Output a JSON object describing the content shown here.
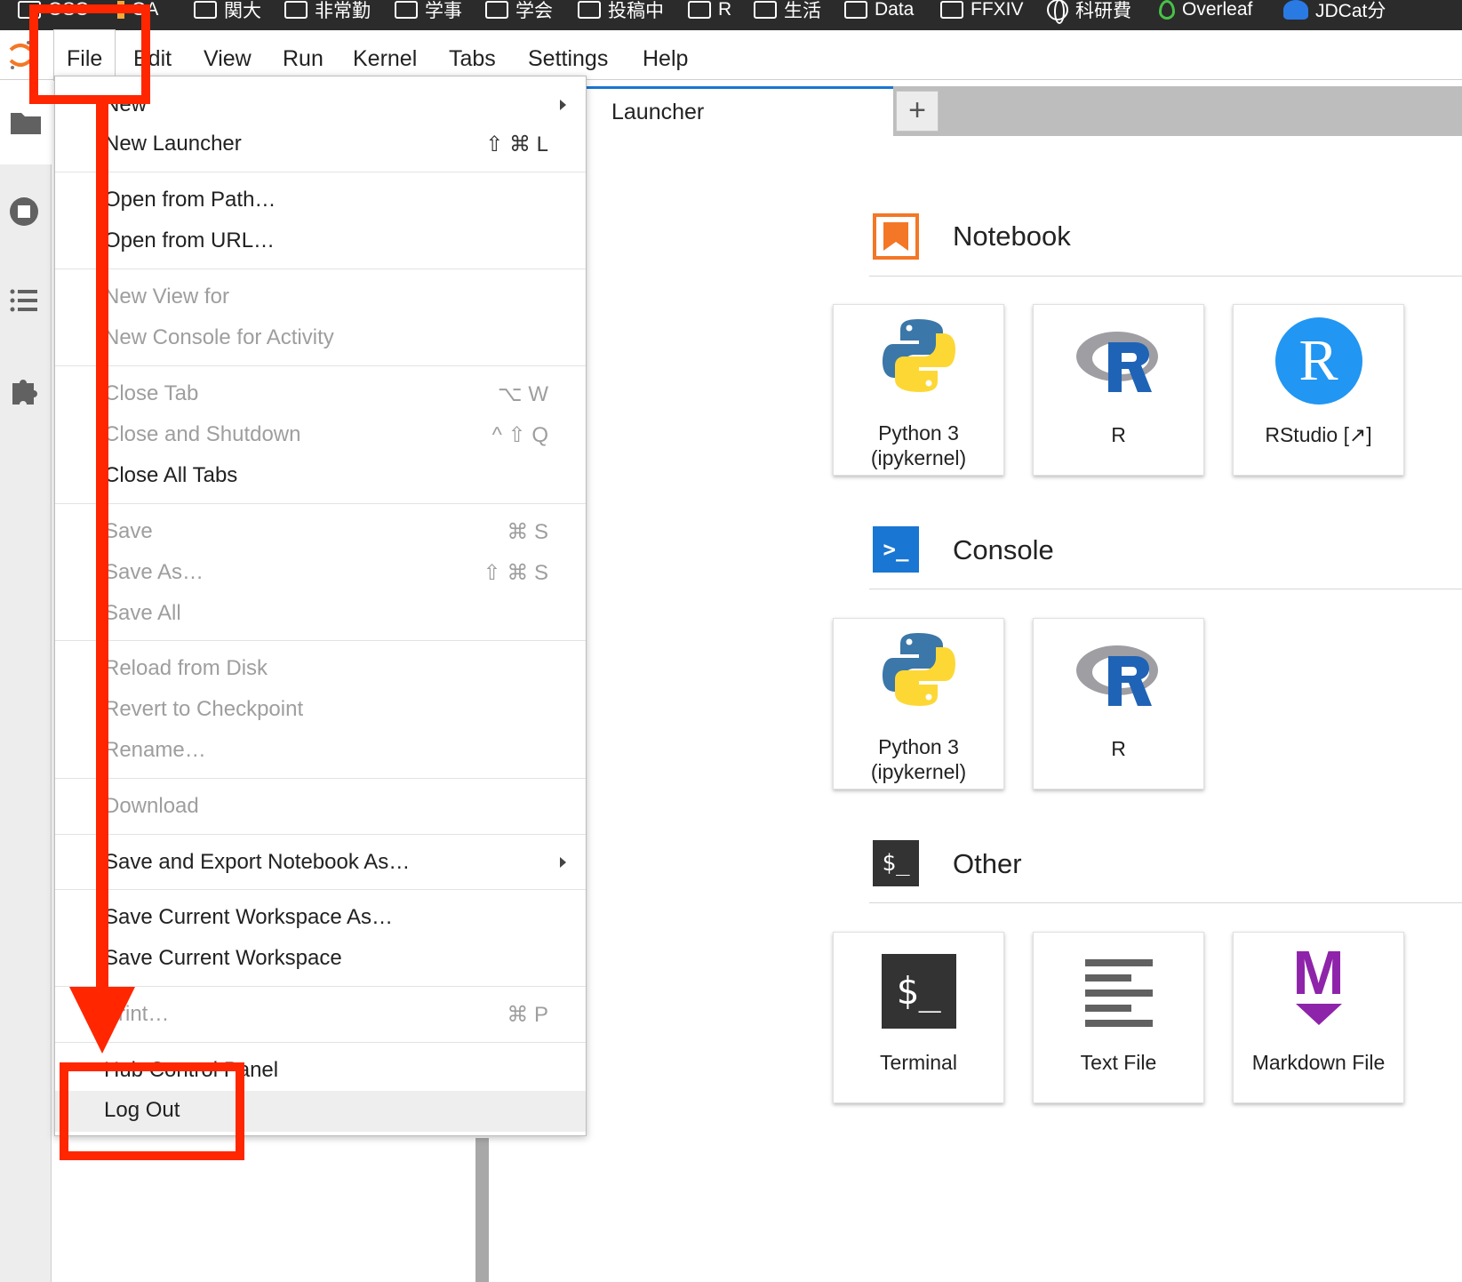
{
  "bookmarks": [
    {
      "label": "OSC",
      "icon": "folder-icon"
    },
    {
      "label": "GA",
      "icon": "chart-icon"
    },
    {
      "label": "関大",
      "icon": "folder-icon"
    },
    {
      "label": "非常勤",
      "icon": "folder-icon"
    },
    {
      "label": "学事",
      "icon": "folder-icon"
    },
    {
      "label": "学会",
      "icon": "folder-icon"
    },
    {
      "label": "投稿中",
      "icon": "folder-icon"
    },
    {
      "label": "R",
      "icon": "folder-icon"
    },
    {
      "label": "生活",
      "icon": "folder-icon"
    },
    {
      "label": "Data",
      "icon": "folder-icon"
    },
    {
      "label": "FFXIV",
      "icon": "folder-icon"
    },
    {
      "label": "科研費",
      "icon": "globe-icon"
    },
    {
      "label": "Overleaf",
      "icon": "leaf-icon"
    },
    {
      "label": "JDCat分",
      "icon": "cat-icon"
    }
  ],
  "menubar": {
    "items": [
      "File",
      "Edit",
      "View",
      "Run",
      "Kernel",
      "Tabs",
      "Settings",
      "Help"
    ]
  },
  "tabs": {
    "active_label": "Launcher",
    "add_label": "+"
  },
  "file_menu": {
    "items": [
      {
        "label": "New",
        "shortcut": "",
        "disabled": false,
        "submenu": true
      },
      {
        "label": "New Launcher",
        "shortcut": "⇧ ⌘ L",
        "disabled": false
      },
      {
        "label": "Open from Path…",
        "shortcut": "",
        "disabled": false
      },
      {
        "label": "Open from URL…",
        "shortcut": "",
        "disabled": false
      },
      {
        "label": "New View for",
        "shortcut": "",
        "disabled": true
      },
      {
        "label": "New Console for Activity",
        "shortcut": "",
        "disabled": true
      },
      {
        "label": "Close Tab",
        "shortcut": "⌥ W",
        "disabled": true
      },
      {
        "label": "Close and Shutdown",
        "shortcut": "^ ⇧ Q",
        "disabled": true
      },
      {
        "label": "Close All Tabs",
        "shortcut": "",
        "disabled": false
      },
      {
        "label": "Save",
        "shortcut": "⌘ S",
        "disabled": true
      },
      {
        "label": "Save As…",
        "shortcut": "⇧ ⌘ S",
        "disabled": true
      },
      {
        "label": "Save All",
        "shortcut": "",
        "disabled": true
      },
      {
        "label": "Reload from Disk",
        "shortcut": "",
        "disabled": true
      },
      {
        "label": "Revert to Checkpoint",
        "shortcut": "",
        "disabled": true
      },
      {
        "label": "Rename…",
        "shortcut": "",
        "disabled": true
      },
      {
        "label": "Download",
        "shortcut": "",
        "disabled": true
      },
      {
        "label": "Save and Export Notebook As…",
        "shortcut": "",
        "disabled": false,
        "submenu": true
      },
      {
        "label": "Save Current Workspace As…",
        "shortcut": "",
        "disabled": false
      },
      {
        "label": "Save Current Workspace",
        "shortcut": "",
        "disabled": false
      },
      {
        "label": "Print…",
        "shortcut": "⌘ P",
        "disabled": true
      },
      {
        "label": "Hub Control Panel",
        "shortcut": "",
        "disabled": false
      },
      {
        "label": "Log Out",
        "shortcut": "",
        "disabled": false,
        "highlighted": true
      }
    ]
  },
  "launcher": {
    "sections": [
      {
        "title": "Notebook",
        "cards": [
          "Python 3\n(ipykernel)",
          "R",
          "RStudio [↗]"
        ]
      },
      {
        "title": "Console",
        "cards": [
          "Python 3\n(ipykernel)",
          "R"
        ]
      },
      {
        "title": "Other",
        "cards": [
          "Terminal",
          "Text File",
          "Markdown File"
        ]
      }
    ],
    "console_icon_text": ">_",
    "other_icon_text": "$_",
    "terminal_art_text": "$_",
    "rstudio_art_text": "R",
    "markdown_art_text": "M"
  },
  "colors": {
    "annotation": "#ff2600",
    "accent": "#1976d2",
    "notebook_orange": "#f37726"
  }
}
